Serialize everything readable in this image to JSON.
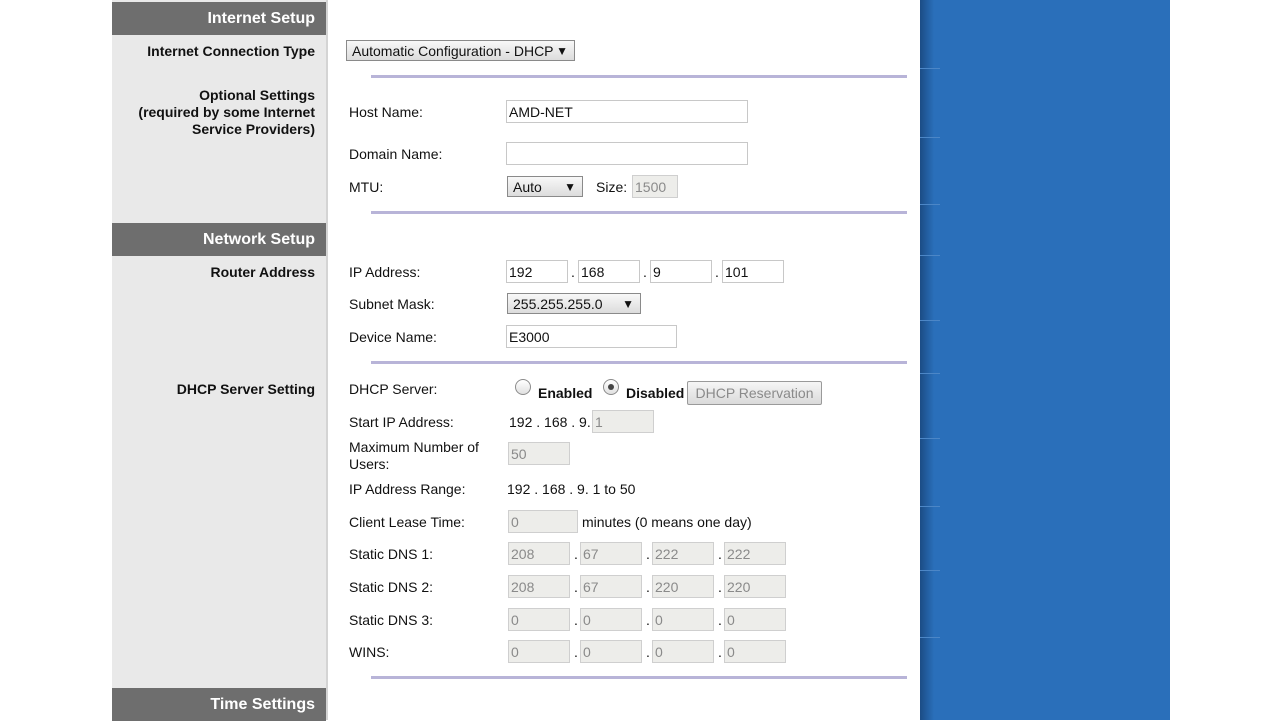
{
  "sections": {
    "internet_setup": "Internet Setup",
    "network_setup": "Network Setup",
    "time_settings": "Time Settings"
  },
  "left_labels": {
    "connection_type": "Internet Connection Type",
    "optional_settings": "Optional Settings",
    "optional_required": "(required by some Internet",
    "optional_providers": "Service Providers)",
    "router_address": "Router Address",
    "dhcp_server_setting": "DHCP Server Setting"
  },
  "internet": {
    "connection_type": "Automatic Configuration - DHCP",
    "host_name_label": "Host Name:",
    "host_name": "AMD-NET",
    "domain_name_label": "Domain Name:",
    "domain_name": "",
    "mtu_label": "MTU:",
    "mtu": "Auto",
    "size_label": "Size:",
    "size": "1500"
  },
  "network": {
    "ip_label": "IP Address:",
    "ip": [
      "192",
      "168",
      "9",
      "101"
    ],
    "subnet_label": "Subnet Mask:",
    "subnet": "255.255.255.0",
    "device_label": "Device Name:",
    "device": "E3000"
  },
  "dhcp": {
    "server_label": "DHCP Server:",
    "enabled": "Enabled",
    "disabled": "Disabled",
    "selected": "Disabled",
    "reservation_button": "DHCP Reservation",
    "start_ip_label": "Start IP  Address:",
    "start_ip_prefix": "192 . 168 . 9.",
    "start_ip_last": "1",
    "max_users_label_1": "Maximum Number of",
    "max_users_label_2": "Users:",
    "max_users": "50",
    "range_label": "IP Address Range:",
    "range": "192 . 168 . 9. 1 to 50",
    "lease_label": "Client Lease Time:",
    "lease": "0",
    "lease_suffix": "minutes (0 means one day)",
    "dns1_label": "Static DNS 1:",
    "dns1": [
      "208",
      "67",
      "222",
      "222"
    ],
    "dns2_label": "Static DNS 2:",
    "dns2": [
      "208",
      "67",
      "220",
      "220"
    ],
    "dns3_label": "Static DNS 3:",
    "dns3": [
      "0",
      "0",
      "0",
      "0"
    ],
    "wins_label": "WINS:",
    "wins": [
      "0",
      "0",
      "0",
      "0"
    ]
  },
  "icons": {
    "select_arrow": "▼"
  },
  "colors": {
    "header_bg": "#6e6e6e",
    "left_bg": "#e9e9e9",
    "right_panel": "#2a6fba",
    "divider": "#b8b4d8"
  }
}
